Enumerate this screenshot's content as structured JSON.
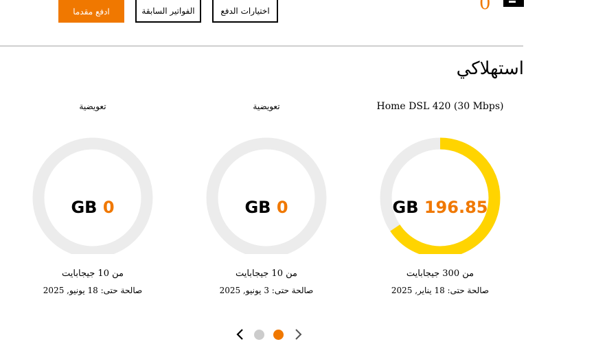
{
  "header": {
    "pay_advance_label": "ادفع مقدما",
    "previous_bills_label": "الفواتير السابقة",
    "payment_options_label": "اختيارات الدفع",
    "balance_value": "0"
  },
  "section": {
    "title": "استهلاكي"
  },
  "cards": [
    {
      "name": "Home DSL 420 (30 Mbps)",
      "unit": "GB",
      "value": "196.85",
      "used_fraction": 0.656,
      "limit_text": "من 300 جيجابايت",
      "validity_text": "صالحة حتى: 18 يناير, 2025"
    },
    {
      "name": "تعويضية",
      "unit": "GB",
      "value": "0",
      "used_fraction": 0,
      "limit_text": "من 10 جيجابايت",
      "validity_text": "صالحة حتى: 3 يونيو, 2025"
    },
    {
      "name": "تعويضية",
      "unit": "GB",
      "value": "0",
      "used_fraction": 0,
      "limit_text": "من 10 جيجابايت",
      "validity_text": "صالحة حتى: 18 يونيو, 2025"
    }
  ],
  "pager": {
    "active_index": 1,
    "total": 2,
    "prev_icon": "chevron-left-icon",
    "next_icon": "chevron-right-icon"
  },
  "colors": {
    "accent": "#f07800",
    "gauge_fill": "#ffd400",
    "gauge_track": "#ececec",
    "dot_inactive": "#cccccc"
  }
}
